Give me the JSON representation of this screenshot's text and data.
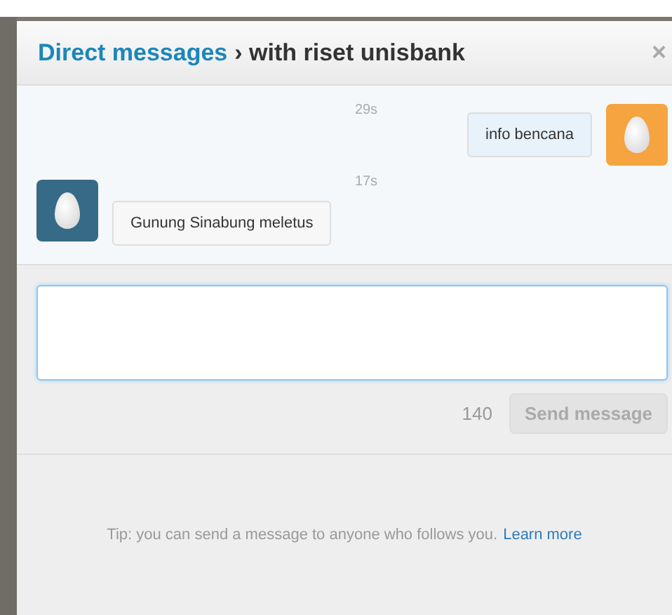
{
  "dialog": {
    "title_link": "Direct messages",
    "title_rest": "› with riset unisbank",
    "close": "×"
  },
  "messages": [
    {
      "kind": "sent",
      "time": "29s",
      "text": "info bencana",
      "color": "#f5a440"
    },
    {
      "kind": "received",
      "time": "17s",
      "text": "Gunung Sinabung meletus",
      "color": "#366a87"
    }
  ],
  "compose": {
    "counter": "140",
    "button": {
      "label": "Send message",
      "disabled": true
    }
  },
  "tip": {
    "text": "Tip: you can send a message to anyone who follows you.",
    "link": "Learn more"
  }
}
